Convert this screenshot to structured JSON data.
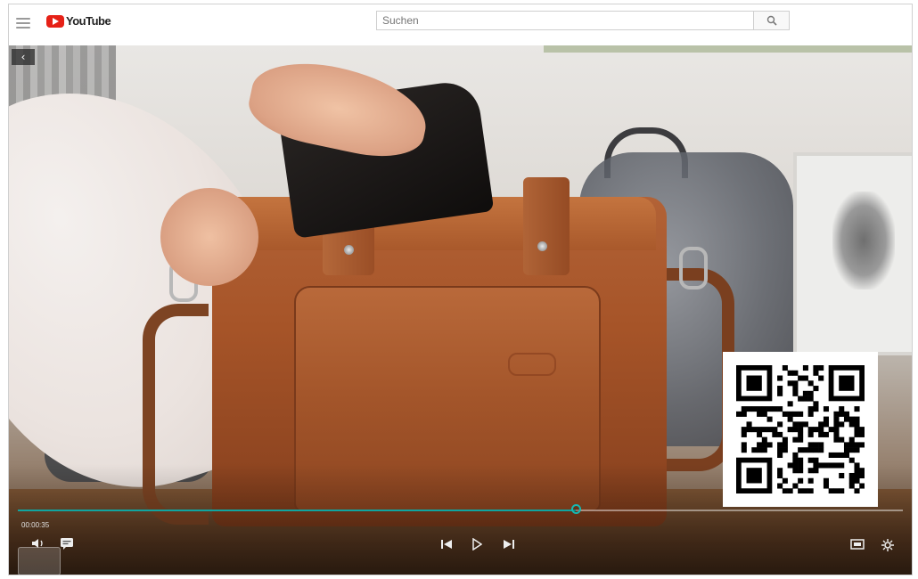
{
  "header": {
    "logo_text": "YouTube",
    "search": {
      "placeholder": "Suchen"
    }
  },
  "player": {
    "progress": 0.63,
    "time_label": "00:00:35",
    "back_label": "‹",
    "icons": {
      "menu": "hamburger-menu-icon",
      "search": "search-icon",
      "subtitles": "subtitles-icon",
      "previous": "previous-icon",
      "play": "play-icon",
      "next": "next-icon",
      "fullscreen": "fullscreen-icon",
      "settings": "settings-icon"
    }
  },
  "colors": {
    "brand": "#e62117",
    "progress": "#10a5a0"
  }
}
